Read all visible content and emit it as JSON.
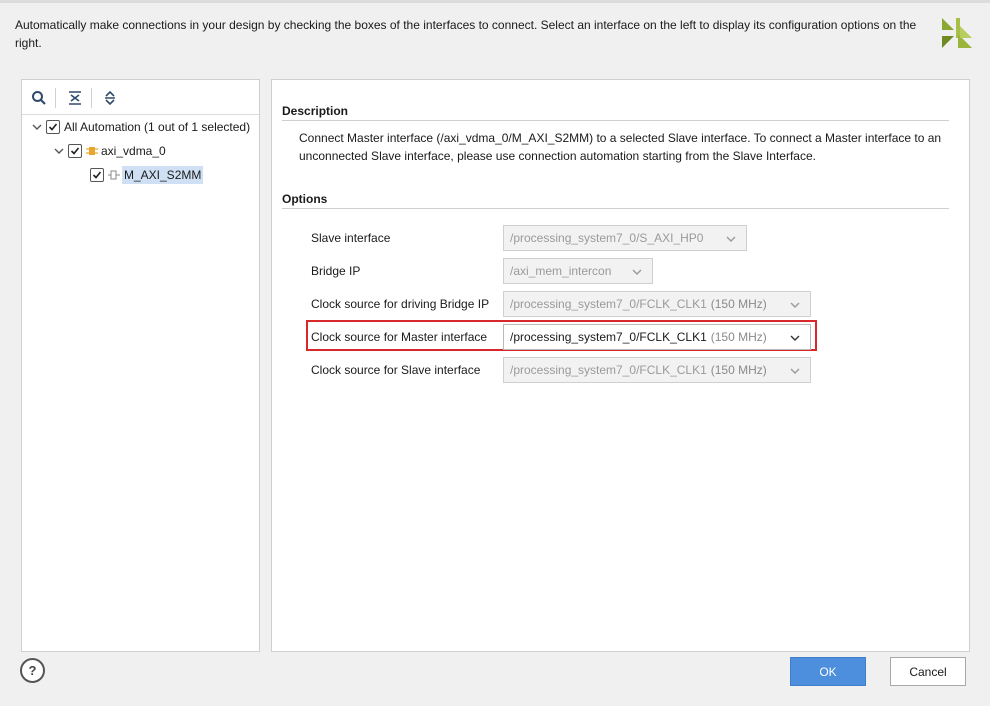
{
  "header": {
    "instructions": "Automatically make connections in your design by checking the boxes of the interfaces to connect. Select an interface on the left to display its configuration options on the right."
  },
  "tree": {
    "root_label": "All Automation (1 out of 1 selected)",
    "ip_label": "axi_vdma_0",
    "interface_label": "M_AXI_S2MM"
  },
  "description": {
    "title": "Description",
    "text": "Connect Master interface (/axi_vdma_0/M_AXI_S2MM) to a selected Slave interface. To connect a Master interface to an unconnected Slave interface, please use connection automation starting from the Slave Interface."
  },
  "options": {
    "title": "Options",
    "slave_interface": {
      "label": "Slave interface",
      "value": "/processing_system7_0/S_AXI_HP0"
    },
    "bridge_ip": {
      "label": "Bridge IP",
      "value": "/axi_mem_intercon"
    },
    "clock_bridge": {
      "label": "Clock source for driving Bridge IP",
      "value": "/processing_system7_0/FCLK_CLK1",
      "freq": "(150 MHz)"
    },
    "clock_master": {
      "label": "Clock source for Master interface",
      "value": "/processing_system7_0/FCLK_CLK1",
      "freq": "(150 MHz)"
    },
    "clock_slave": {
      "label": "Clock source for Slave interface",
      "value": "/processing_system7_0/FCLK_CLK1",
      "freq": "(150 MHz)"
    }
  },
  "footer": {
    "help_label": "?",
    "ok_label": "OK",
    "cancel_label": "Cancel"
  },
  "colors": {
    "ok_blue": "#4d8fdc",
    "highlight_red": "#d9282b",
    "selection_blue": "#cfe0f5",
    "logo_green": "#8aa832"
  }
}
